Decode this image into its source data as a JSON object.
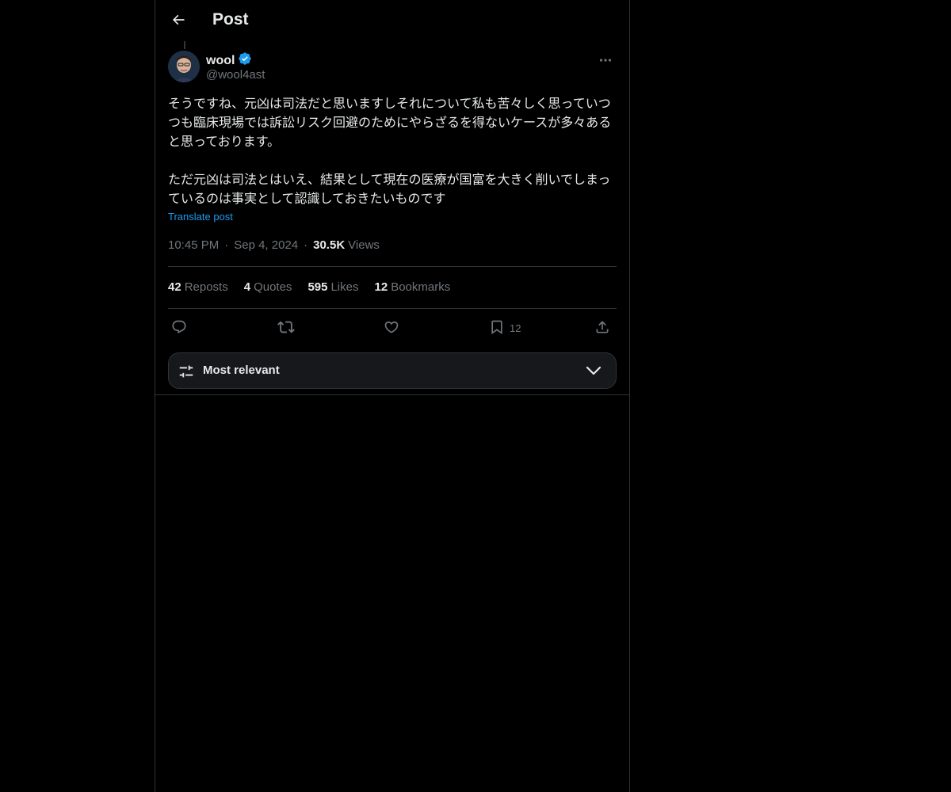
{
  "header": {
    "title": "Post"
  },
  "author": {
    "name": "wool",
    "handle": "@wool4ast",
    "verified": true
  },
  "post": {
    "text": "そうですね、元凶は司法だと思いますしそれについて私も苦々しく思っていつつも臨床現場では訴訟リスク回避のためにやらざるを得ないケースが多々あると思っております。\n\nただ元凶は司法とはいえ、結果として現在の医療が国富を大きく削いでしまっているのは事実として認識しておきたいものです",
    "translate_label": "Translate post",
    "time": "10:45 PM",
    "date": "Sep 4, 2024",
    "separator": "·",
    "views_count": "30.5K",
    "views_label": "Views"
  },
  "stats": [
    {
      "count": "42",
      "label": "Reposts"
    },
    {
      "count": "4",
      "label": "Quotes"
    },
    {
      "count": "595",
      "label": "Likes"
    },
    {
      "count": "12",
      "label": "Bookmarks"
    }
  ],
  "actions": {
    "bookmark_count": "12"
  },
  "sort": {
    "label": "Most relevant"
  },
  "colors": {
    "background": "#000000",
    "text": "#e7e9ea",
    "muted": "#71767b",
    "accent": "#1d9bf0",
    "border": "#2f3336"
  }
}
